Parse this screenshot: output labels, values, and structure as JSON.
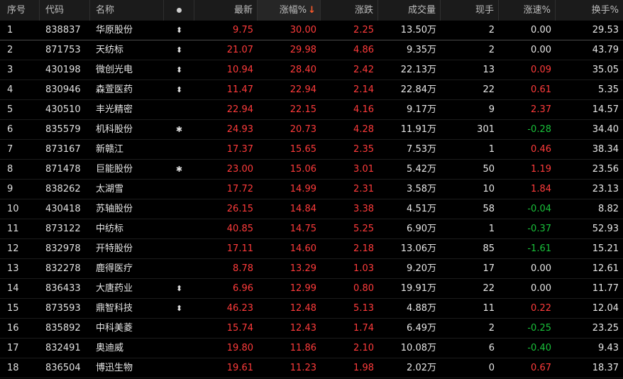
{
  "header": {
    "seq": "序号",
    "code": "代码",
    "name": "名称",
    "latest": "最新",
    "change_pct": "涨幅%",
    "sort_arrow": "↓",
    "change": "涨跌",
    "volume": "成交量",
    "current_vol": "现手",
    "speed": "涨速%",
    "turnover": "换手%"
  },
  "rows": [
    {
      "seq": "1",
      "code": "838837",
      "name": "华原股份",
      "mark": "⬍",
      "latest": "9.75",
      "pct": "30.00",
      "chg": "2.25",
      "vol": "13.50万",
      "hand": "2",
      "speed": "0.00",
      "speed_dir": "flat",
      "turn": "29.53"
    },
    {
      "seq": "2",
      "code": "871753",
      "name": "天纺标",
      "mark": "⬍",
      "latest": "21.07",
      "pct": "29.98",
      "chg": "4.86",
      "vol": "9.35万",
      "hand": "2",
      "speed": "0.00",
      "speed_dir": "flat",
      "turn": "43.79"
    },
    {
      "seq": "3",
      "code": "430198",
      "name": "微创光电",
      "mark": "⬍",
      "latest": "10.94",
      "pct": "28.40",
      "chg": "2.42",
      "vol": "22.13万",
      "hand": "13",
      "speed": "0.09",
      "speed_dir": "up",
      "turn": "35.05"
    },
    {
      "seq": "4",
      "code": "830946",
      "name": "森萱医药",
      "mark": "⬍",
      "latest": "11.47",
      "pct": "22.94",
      "chg": "2.14",
      "vol": "22.84万",
      "hand": "22",
      "speed": "0.61",
      "speed_dir": "up",
      "turn": "5.35"
    },
    {
      "seq": "5",
      "code": "430510",
      "name": "丰光精密",
      "mark": "",
      "latest": "22.94",
      "pct": "22.15",
      "chg": "4.16",
      "vol": "9.17万",
      "hand": "9",
      "speed": "2.37",
      "speed_dir": "up",
      "turn": "14.57"
    },
    {
      "seq": "6",
      "code": "835579",
      "name": "机科股份",
      "mark": "✱",
      "latest": "24.93",
      "pct": "20.73",
      "chg": "4.28",
      "vol": "11.91万",
      "hand": "301",
      "speed": "-0.28",
      "speed_dir": "down",
      "turn": "34.40"
    },
    {
      "seq": "7",
      "code": "873167",
      "name": "新赣江",
      "mark": "",
      "latest": "17.37",
      "pct": "15.65",
      "chg": "2.35",
      "vol": "7.53万",
      "hand": "1",
      "speed": "0.46",
      "speed_dir": "up",
      "turn": "38.34"
    },
    {
      "seq": "8",
      "code": "871478",
      "name": "巨能股份",
      "mark": "✱",
      "latest": "23.00",
      "pct": "15.06",
      "chg": "3.01",
      "vol": "5.42万",
      "hand": "50",
      "speed": "1.19",
      "speed_dir": "up",
      "turn": "23.56"
    },
    {
      "seq": "9",
      "code": "838262",
      "name": "太湖雪",
      "mark": "",
      "latest": "17.72",
      "pct": "14.99",
      "chg": "2.31",
      "vol": "3.58万",
      "hand": "10",
      "speed": "1.84",
      "speed_dir": "up",
      "turn": "23.13"
    },
    {
      "seq": "10",
      "code": "430418",
      "name": "苏轴股份",
      "mark": "",
      "latest": "26.15",
      "pct": "14.84",
      "chg": "3.38",
      "vol": "4.51万",
      "hand": "58",
      "speed": "-0.04",
      "speed_dir": "down",
      "turn": "8.82"
    },
    {
      "seq": "11",
      "code": "873122",
      "name": "中纺标",
      "mark": "",
      "latest": "40.85",
      "pct": "14.75",
      "chg": "5.25",
      "vol": "6.90万",
      "hand": "1",
      "speed": "-0.37",
      "speed_dir": "down",
      "turn": "52.93"
    },
    {
      "seq": "12",
      "code": "832978",
      "name": "开特股份",
      "mark": "",
      "latest": "17.11",
      "pct": "14.60",
      "chg": "2.18",
      "vol": "13.06万",
      "hand": "85",
      "speed": "-1.61",
      "speed_dir": "down",
      "turn": "15.21"
    },
    {
      "seq": "13",
      "code": "832278",
      "name": "鹿得医疗",
      "mark": "",
      "latest": "8.78",
      "pct": "13.29",
      "chg": "1.03",
      "vol": "9.20万",
      "hand": "17",
      "speed": "0.00",
      "speed_dir": "flat",
      "turn": "12.61"
    },
    {
      "seq": "14",
      "code": "836433",
      "name": "大唐药业",
      "mark": "⬍",
      "latest": "6.96",
      "pct": "12.99",
      "chg": "0.80",
      "vol": "19.91万",
      "hand": "22",
      "speed": "0.00",
      "speed_dir": "flat",
      "turn": "11.77"
    },
    {
      "seq": "15",
      "code": "873593",
      "name": "鼎智科技",
      "mark": "⬍",
      "latest": "46.23",
      "pct": "12.48",
      "chg": "5.13",
      "vol": "4.88万",
      "hand": "11",
      "speed": "0.22",
      "speed_dir": "up",
      "turn": "12.04"
    },
    {
      "seq": "16",
      "code": "835892",
      "name": "中科美菱",
      "mark": "",
      "latest": "15.74",
      "pct": "12.43",
      "chg": "1.74",
      "vol": "6.49万",
      "hand": "2",
      "speed": "-0.25",
      "speed_dir": "down",
      "turn": "23.25"
    },
    {
      "seq": "17",
      "code": "832491",
      "name": "奥迪威",
      "mark": "",
      "latest": "19.80",
      "pct": "11.86",
      "chg": "2.10",
      "vol": "10.08万",
      "hand": "6",
      "speed": "-0.40",
      "speed_dir": "down",
      "turn": "9.43"
    },
    {
      "seq": "18",
      "code": "836504",
      "name": "博迅生物",
      "mark": "",
      "latest": "19.61",
      "pct": "11.23",
      "chg": "1.98",
      "vol": "2.02万",
      "hand": "0",
      "speed": "0.67",
      "speed_dir": "up",
      "turn": "18.37"
    }
  ]
}
